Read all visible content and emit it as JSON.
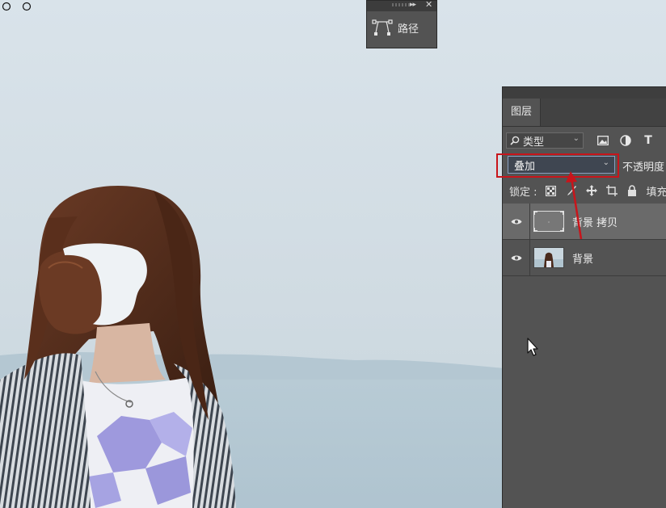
{
  "paths_panel": {
    "collapse_glyph": "▸▸",
    "close_glyph": "✕",
    "button_label": "路径",
    "icon": "path-icon"
  },
  "layers_panel": {
    "tab_label": "图层",
    "filter": {
      "search_icon": "search-icon",
      "kind_label": "类型",
      "icons": [
        "image-filter-icon",
        "adjustment-filter-icon",
        "type-filter-icon"
      ],
      "type_glyph": "T"
    },
    "blend_mode": "叠加",
    "opacity_label": "不透明度",
    "lock_label": "锁定 :",
    "fill_label": "填充",
    "layers": [
      {
        "name": "背景 拷贝",
        "visible": true,
        "selected": true
      },
      {
        "name": "背景",
        "visible": true,
        "selected": false
      }
    ]
  },
  "annotation": {
    "highlight_color": "#c8151b"
  },
  "colors": {
    "panel_bg": "#535353",
    "selected_row": "#6a6a6a",
    "sky": "#d5dfe6"
  }
}
